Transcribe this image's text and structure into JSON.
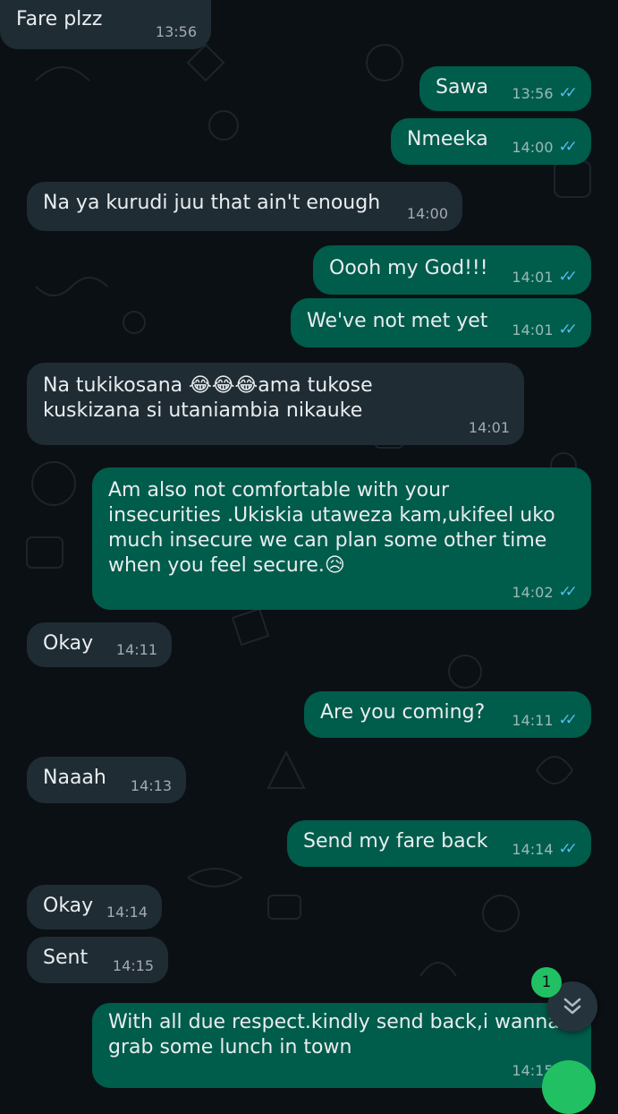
{
  "messages": [
    {
      "dir": "in",
      "text": "Fare plzz",
      "time": "13:56"
    },
    {
      "dir": "out",
      "text": "Sawa",
      "time": "13:56",
      "read": true
    },
    {
      "dir": "out",
      "text": "Nmeeka",
      "time": "14:00",
      "read": true
    },
    {
      "dir": "in",
      "text": "Na ya kurudi juu that ain't enough",
      "time": "14:00"
    },
    {
      "dir": "out",
      "text": "Oooh my God!!!",
      "time": "14:01",
      "read": true
    },
    {
      "dir": "out",
      "text": "We've not met yet",
      "time": "14:01",
      "read": true
    },
    {
      "dir": "in",
      "text": "Na tukikosana 😂😂😂ama tukose\nkuskizana si utaniambia nikauke",
      "time": "14:01"
    },
    {
      "dir": "out",
      "text": "Am also not comfortable with your\ninsecurities .Ukiskia utaweza kam,ukifeel uko\nmuch insecure we can plan some other time\nwhen you feel secure.😥",
      "time": "14:02",
      "read": true
    },
    {
      "dir": "in",
      "text": "Okay",
      "time": "14:11"
    },
    {
      "dir": "out",
      "text": "Are you coming?",
      "time": "14:11",
      "read": true
    },
    {
      "dir": "in",
      "text": "Naaah",
      "time": "14:13"
    },
    {
      "dir": "out",
      "text": "Send my fare back",
      "time": "14:14",
      "read": true
    },
    {
      "dir": "in",
      "text": "Okay",
      "time": "14:14"
    },
    {
      "dir": "in",
      "text": "Sent",
      "time": "14:15"
    },
    {
      "dir": "out",
      "text": "With all due respect.kindly send back,i wanna\ngrab some lunch in town",
      "time": "14:15",
      "read": true
    }
  ],
  "scroll_button": {
    "icon": "double-chevron-down-icon",
    "unread_count": "1"
  },
  "fab": {
    "icon": "chat-fab-icon"
  },
  "colors": {
    "background": "#0b1014",
    "incoming_bubble": "#1f2c34",
    "outgoing_bubble": "#005c4b",
    "read_ticks": "#53bdeb",
    "accent_green": "#21c063"
  }
}
